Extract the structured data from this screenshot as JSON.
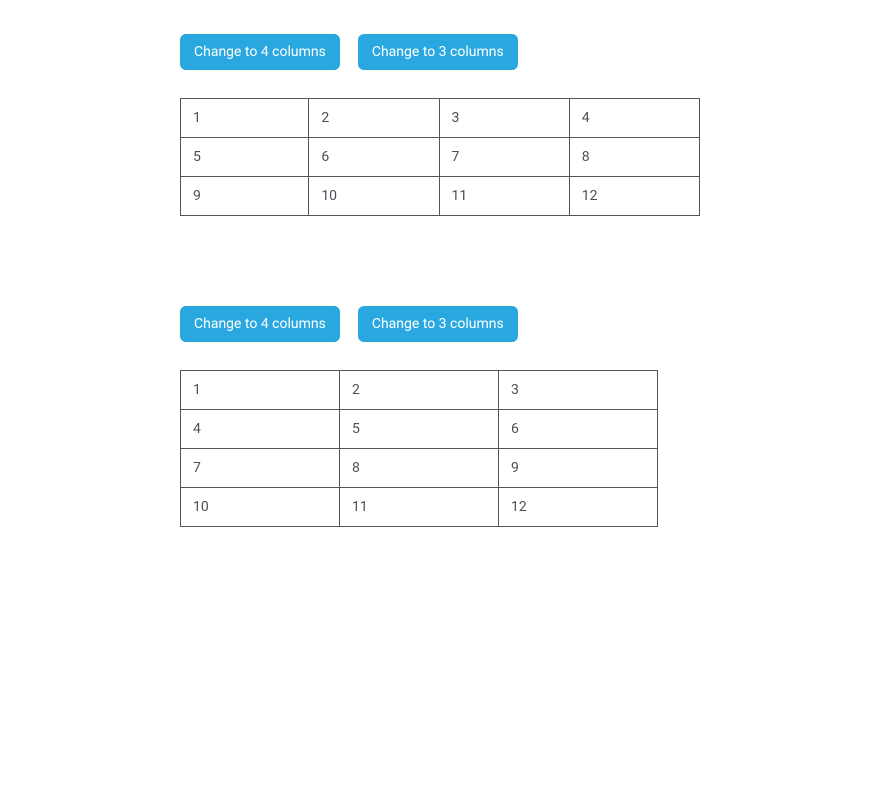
{
  "buttons": {
    "change_to_4": "Change to 4 columns",
    "change_to_3": "Change to 3 columns"
  },
  "table1": {
    "columns": 4,
    "cells": [
      [
        "1",
        "2",
        "3",
        "4"
      ],
      [
        "5",
        "6",
        "7",
        "8"
      ],
      [
        "9",
        "10",
        "11",
        "12"
      ]
    ]
  },
  "table2": {
    "columns": 3,
    "cells": [
      [
        "1",
        "2",
        "3"
      ],
      [
        "4",
        "5",
        "6"
      ],
      [
        "7",
        "8",
        "9"
      ],
      [
        "10",
        "11",
        "12"
      ]
    ]
  }
}
